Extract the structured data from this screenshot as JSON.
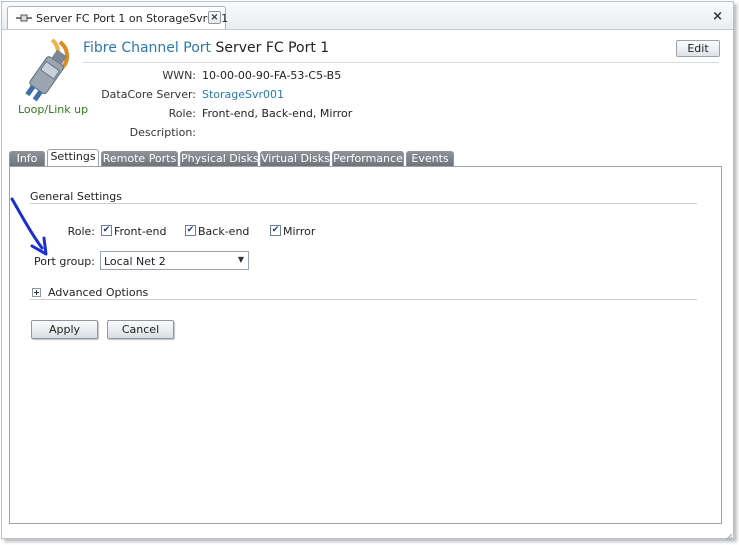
{
  "window": {
    "tab_title": "Server FC Port 1 on StorageSvr001",
    "close_glyph": "×"
  },
  "header": {
    "type_label": "Fibre Channel Port",
    "name": "Server FC Port 1",
    "status": "Loop/Link up",
    "edit_label": "Edit"
  },
  "properties": [
    {
      "label": "WWN:",
      "value": "10-00-00-90-FA-53-C5-B5"
    },
    {
      "label": "DataCore Server:",
      "value": "StorageSvr001"
    },
    {
      "label": "Role:",
      "value": "Front-end, Back-end, Mirror"
    },
    {
      "label": "Description:",
      "value": ""
    }
  ],
  "tabs": [
    {
      "label": "Info"
    },
    {
      "label": "Settings"
    },
    {
      "label": "Remote Ports"
    },
    {
      "label": "Physical Disks"
    },
    {
      "label": "Virtual Disks"
    },
    {
      "label": "Performance"
    },
    {
      "label": "Events"
    }
  ],
  "settings": {
    "section_title": "General Settings",
    "role_label": "Role:",
    "roles": [
      {
        "label": "Front-end",
        "checked": true
      },
      {
        "label": "Back-end",
        "checked": true
      },
      {
        "label": "Mirror",
        "checked": true
      }
    ],
    "port_group_label": "Port group:",
    "port_group_value": "Local Net 2",
    "advanced_label": "Advanced Options",
    "apply_label": "Apply",
    "cancel_label": "Cancel"
  },
  "icons": {
    "tab_icon": "fc-port-icon",
    "header_image": "fc-connector-icon",
    "annotation": "blue-arrow"
  },
  "colors": {
    "link": "#2a7ab0",
    "status": "#2e7d1a",
    "annotation_arrow": "#1a2fd0"
  }
}
